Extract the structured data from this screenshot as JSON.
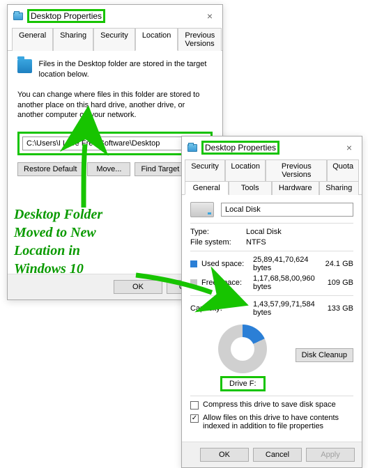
{
  "dlg1": {
    "title": "Desktop Properties",
    "tabs": [
      "General",
      "Sharing",
      "Security",
      "Location",
      "Previous Versions"
    ],
    "intro": "Files in the Desktop folder are stored in the target location below.",
    "para": "You can change where files in this folder are stored to another place on this hard drive, another drive, or another computer on your network.",
    "path": "C:\\Users\\I Love Free Software\\Desktop",
    "buttons": {
      "restore": "Restore Default",
      "move": "Move...",
      "find": "Find Target"
    },
    "footer": {
      "ok": "OK",
      "cancel": "Cancel"
    }
  },
  "dlg2": {
    "title": "Desktop Properties",
    "tabs_row1": [
      "Security",
      "Location",
      "Previous Versions",
      "Quota"
    ],
    "tabs_row2": [
      "General",
      "Tools",
      "Hardware",
      "Sharing"
    ],
    "volume_value": "Local Disk",
    "type_label": "Type:",
    "type_value": "Local Disk",
    "fs_label": "File system:",
    "fs_value": "NTFS",
    "used_label": "Used space:",
    "used_bytes": "25,89,41,70,624 bytes",
    "used_gb": "24.1 GB",
    "free_label": "Free space:",
    "free_bytes": "1,17,68,58,00,960 bytes",
    "free_gb": "109 GB",
    "cap_label": "Capacity:",
    "cap_bytes": "1,43,57,99,71,584 bytes",
    "cap_gb": "133 GB",
    "drive_label": "Drive F:",
    "cleanup": "Disk Cleanup",
    "compress": "Compress this drive to save disk space",
    "index": "Allow files on this drive to have contents indexed in addition to file properties",
    "footer": {
      "ok": "OK",
      "cancel": "Cancel",
      "apply": "Apply"
    }
  },
  "annotation": {
    "l1": "Desktop Folder",
    "l2": "Moved to New",
    "l3": "Location in",
    "l4": "Windows 10"
  },
  "colors": {
    "accent_green": "#17c400"
  }
}
